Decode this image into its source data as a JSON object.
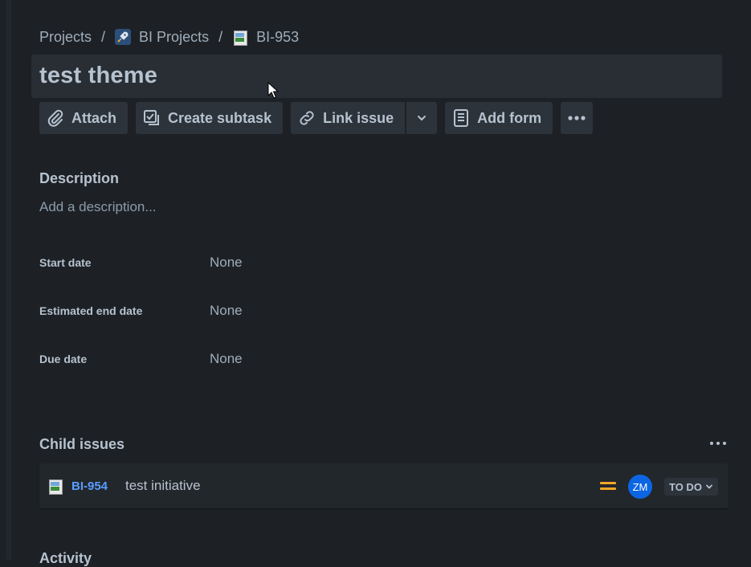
{
  "breadcrumb": {
    "projects": "Projects",
    "separator": "/",
    "project_name": "BI Projects",
    "issue_key": "BI-953"
  },
  "issue": {
    "title": "test theme"
  },
  "toolbar": {
    "attach": "Attach",
    "create_subtask": "Create subtask",
    "link_issue": "Link issue",
    "add_form": "Add form"
  },
  "description": {
    "label": "Description",
    "placeholder": "Add a description..."
  },
  "fields": [
    {
      "label": "Start date",
      "value": "None"
    },
    {
      "label": "Estimated end date",
      "value": "None"
    },
    {
      "label": "Due date",
      "value": "None"
    }
  ],
  "child_issues": {
    "label": "Child issues",
    "items": [
      {
        "key": "BI-954",
        "summary": "test initiative",
        "priority": "medium",
        "assignee_initials": "ZM",
        "status": "TO DO"
      }
    ]
  },
  "activity": {
    "label": "Activity"
  },
  "colors": {
    "background": "#1d2125",
    "link": "#579dff",
    "priority_medium": "#f5a623",
    "avatar": "#0c66e4"
  },
  "icons": [
    "rocket-icon",
    "broken-image-icon",
    "paperclip-icon",
    "subtask-icon",
    "link-icon",
    "chevron-down-icon",
    "form-icon",
    "more-icon"
  ]
}
